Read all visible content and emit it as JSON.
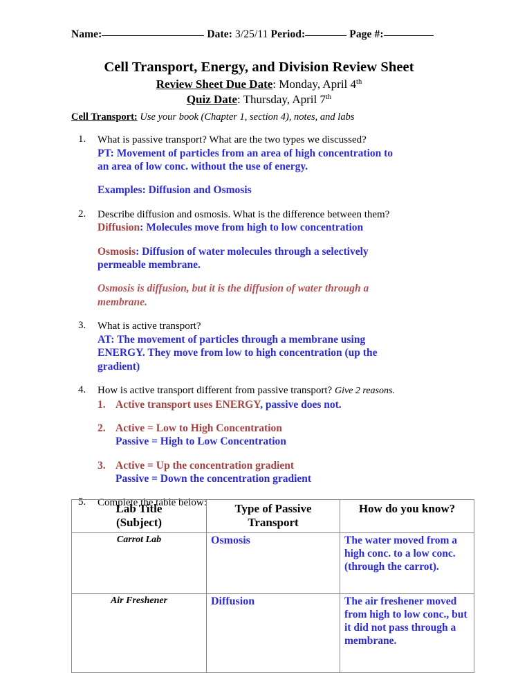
{
  "header": {
    "name_label": "Name:",
    "date_label": "Date:",
    "date_value": "3/25/11",
    "period_label": "Period:",
    "page_label": "Page #:"
  },
  "title": {
    "main": "Cell Transport, Energy, and Division Review Sheet",
    "due_label": "Review Sheet Due Date",
    "due_value": ": Monday, April 4",
    "due_sup": "th",
    "quiz_label": "Quiz Date",
    "quiz_value": ": Thursday, April 7",
    "quiz_sup": "th"
  },
  "section": {
    "label": "Cell Transport:",
    "note": " Use your book (Chapter 1, section 4), notes, and labs"
  },
  "questions": [
    {
      "num": "1.",
      "prompt": "What is passive transport?  What are the two types we discussed?",
      "answer_line1": "PT: Movement of particles from an area of high concentration to",
      "answer_line2": "an area of low conc. without the use of energy.",
      "answer_extra": "Examples: Diffusion and Osmosis"
    },
    {
      "num": "2.",
      "prompt": "Describe diffusion and osmosis.  What is the difference between them?",
      "a1_label": "Diffusion",
      "a1_rest": ": Molecules move from high to low concentration",
      "a2_label": "Osmosis",
      "a2_rest_line1": ": Diffusion of water molecules through a selectively",
      "a2_rest_line2": "permeable membrane.",
      "italic_line1": "Osmosis is diffusion, but it is the diffusion of water through a",
      "italic_line2": "membrane."
    },
    {
      "num": "3.",
      "prompt": "What is active transport?",
      "answer_line1": "AT: The movement of particles through a membrane using",
      "answer_line2": "ENERGY.  They move from low to high concentration (up the",
      "answer_line3": "gradient)"
    },
    {
      "num": "4.",
      "prompt": "How is active transport different from passive transport?",
      "prompt_italic": "Give 2 reasons.",
      "reasons": [
        {
          "num": "1.",
          "red_part": "Active transport uses ENERGY",
          "blue_part": ", passive does not."
        },
        {
          "num": "2.",
          "red_part": "Active = Low to High Concentration",
          "blue_part": "Passive = High to Low Concentration"
        },
        {
          "num": "3.",
          "red_part": "Active = Up the concentration gradient",
          "blue_part": "Passive = Down the concentration gradient"
        }
      ]
    },
    {
      "num": "5.",
      "prompt": "Complete the table below:"
    }
  ],
  "table": {
    "headers": [
      {
        "line1": "Lab Title",
        "line2": "(Subject)"
      },
      {
        "line1": "Type of Passive",
        "line2": "Transport"
      },
      {
        "line1": "How do you know?",
        "line2": ""
      }
    ],
    "rows": [
      {
        "lab": "Carrot Lab",
        "type": "Osmosis",
        "how": "The water moved from a high conc. to a low conc. (through the carrot)."
      },
      {
        "lab": "Air Freshener",
        "type": "Diffusion",
        "how": "The air freshener moved from high to low conc., but it did not pass through a membrane."
      }
    ]
  },
  "colors": {
    "blue": "#2b2bd4",
    "red": "#a44242",
    "border": "#8a8a8a"
  }
}
